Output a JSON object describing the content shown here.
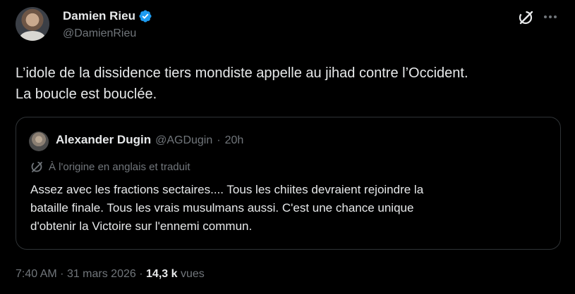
{
  "author": {
    "name": "Damien Rieu",
    "handle": "@DamienRieu",
    "avatar_icon": "user-avatar"
  },
  "tweet": {
    "lines": [
      "L’idole de la dissidence tiers mondiste appelle au jihad contre l’Occident.",
      "La boucle est bouclée."
    ]
  },
  "quoted": {
    "name": "Alexander Dugin",
    "handle": "@AGDugin",
    "separator": "·",
    "time": "20h",
    "translation_note": "À l'origine en anglais et traduit",
    "lines": [
      "Assez avec les fractions sectaires.... Tous les chiites devraient rejoindre la",
      "bataille finale. Tous les vrais musulmans aussi. C'est une chance unique",
      "d'obtenir la Victoire sur l'ennemi commun."
    ]
  },
  "footer": {
    "time": "7:40 AM",
    "sep1": "·",
    "date": "31 mars 2026",
    "sep2": "·",
    "views_count": "14,3 k",
    "views_label": "vues"
  },
  "colors": {
    "background": "#000000",
    "text": "#e7e9ea",
    "muted": "#71767b",
    "verified": "#1d9bf0",
    "border": "#2f3336"
  }
}
